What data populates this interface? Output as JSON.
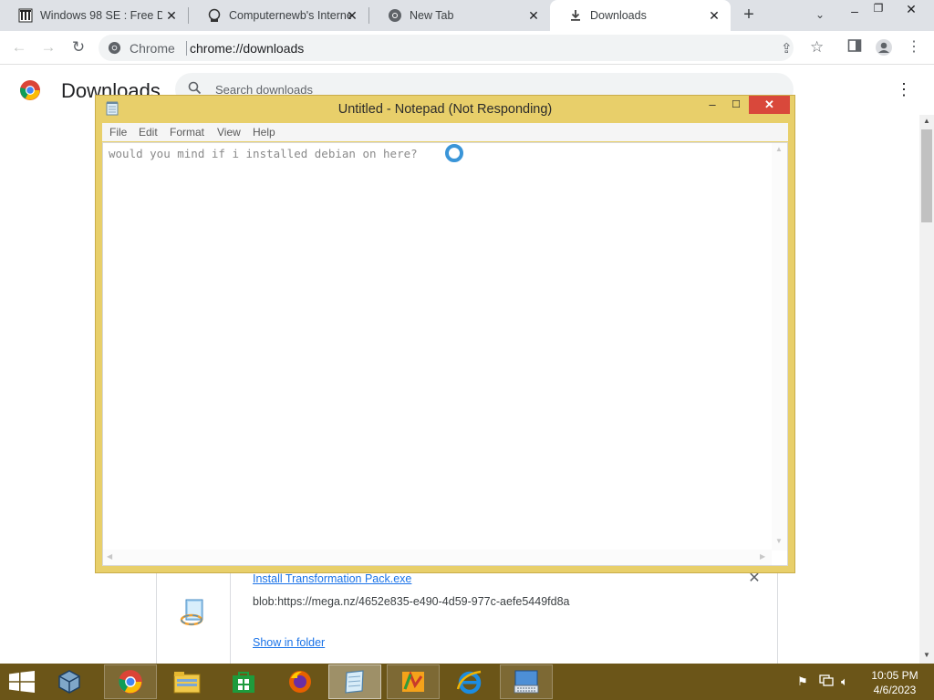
{
  "browser": {
    "tabs": [
      {
        "title": "Windows 98 SE : Free Do",
        "icon": "archive-icon"
      },
      {
        "title": "Computernewb's Interne",
        "icon": "computernewb-icon"
      },
      {
        "title": "New Tab",
        "icon": "chrome-icon"
      },
      {
        "title": "Downloads",
        "icon": "download-icon",
        "active": true
      }
    ],
    "omnibox": {
      "site": "Chrome",
      "url": "chrome://downloads"
    }
  },
  "downloads": {
    "title": "Downloads",
    "search_placeholder": "Search downloads",
    "item": {
      "filename": "Install Transformation Pack.exe",
      "url": "blob:https://mega.nz/4652e835-e490-4d59-977c-aefe5449fd8a",
      "show_in_folder": "Show in folder"
    }
  },
  "notepad": {
    "title": "Untitled - Notepad (Not Responding)",
    "menu": [
      "File",
      "Edit",
      "Format",
      "View",
      "Help"
    ],
    "text": "would you mind if i installed debian on here?"
  },
  "taskbar": {
    "apps": [
      "virtualbox-icon",
      "chrome-icon",
      "file-explorer-icon",
      "store-icon",
      "firefox-icon",
      "notepad-icon",
      "transformation-pack-icon",
      "internet-explorer-icon",
      "on-screen-keyboard-icon"
    ],
    "time": "10:05 PM",
    "date": "4/6/2023"
  },
  "colors": {
    "window_frame": "#e8cf6a",
    "taskbar": "#6b5518",
    "close_button": "#d9483b",
    "link": "#1a73e8"
  }
}
